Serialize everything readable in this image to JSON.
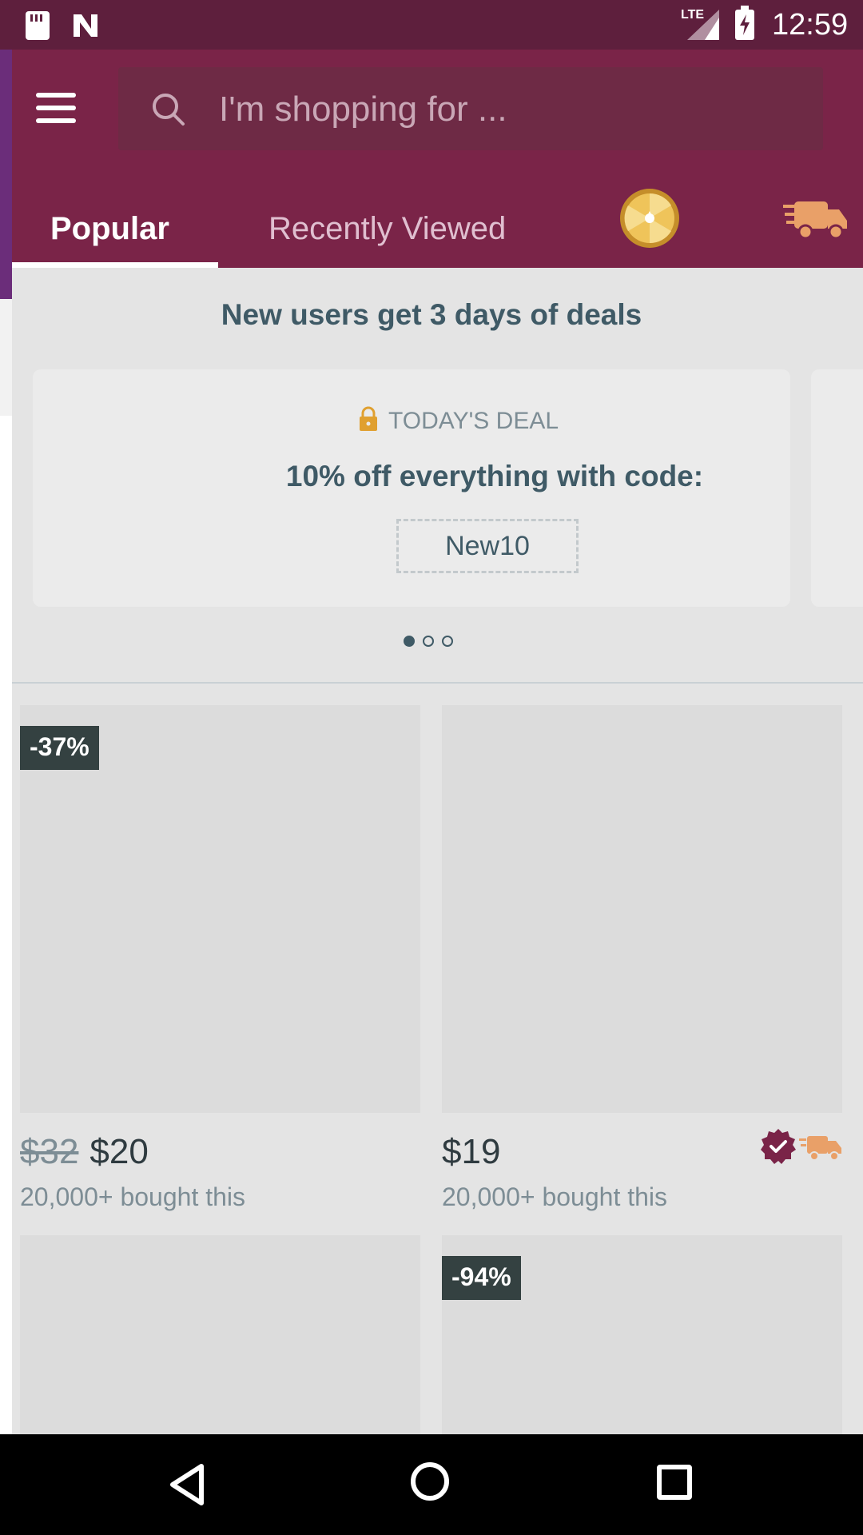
{
  "status_bar": {
    "network": "LTE",
    "time": "12:59"
  },
  "search": {
    "placeholder": "I'm shopping for ..."
  },
  "tabs": [
    {
      "label": "Popular"
    },
    {
      "label": "Recently Viewed"
    }
  ],
  "promo": {
    "title": "New users get 3 days of deals",
    "deal_label": "TODAY'S DEAL",
    "deal_text": "10% off everything with code:",
    "code": "New10",
    "pages": 3,
    "active_page": 1
  },
  "products": [
    {
      "discount": "-37%",
      "old_price": "$32",
      "price": "$20",
      "bought": "20,000+ bought this"
    },
    {
      "discount": "",
      "old_price": "",
      "price": "$19",
      "bought": "20,000+ bought this"
    },
    {
      "discount": "",
      "price": ""
    },
    {
      "discount": "-94%",
      "price": ""
    }
  ],
  "colors": {
    "brand": "#7a2448",
    "status_bar": "#5e1f3d",
    "accent": "#e0a030",
    "text": "#3f5a66"
  }
}
